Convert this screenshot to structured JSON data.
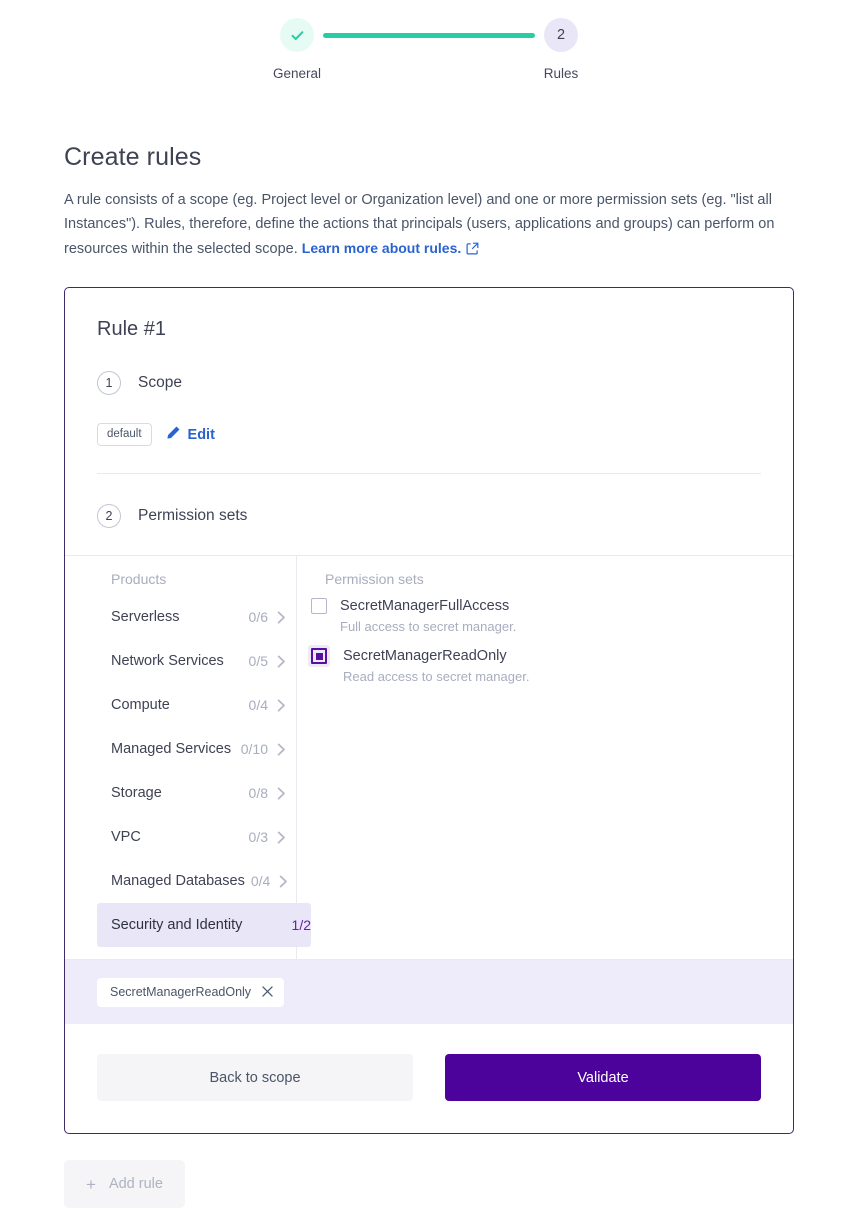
{
  "stepper": {
    "steps": [
      {
        "label": "General",
        "state": "done",
        "icon": "check-icon"
      },
      {
        "label": "Rules",
        "state": "current",
        "number": "2"
      }
    ],
    "line_color": "#27cda5",
    "done_bg": "#e6fbf4",
    "current_bg": "#e9e7f7"
  },
  "page": {
    "title": "Create rules",
    "description_part1": "A rule consists of a scope (eg. Project level or Organization level) and one or more permission sets (eg. \"list all Instances\"). Rules, therefore, define the actions that principals (users, applications and groups) can perform on resources within the selected scope. ",
    "link_text": "Learn more about rules.",
    "link_icon": "external-link-icon"
  },
  "rule_card": {
    "border_color": "#3d2a6b",
    "title": "Rule #1",
    "scope_section": {
      "number": "1",
      "title": "Scope",
      "badge": "default",
      "edit_label": "Edit",
      "edit_icon": "pencil-icon"
    },
    "permission_section": {
      "number": "2",
      "title": "Permission sets"
    },
    "picker": {
      "products_header": "Products",
      "permissions_header": "Permission sets",
      "products": [
        {
          "name": "Serverless",
          "count": "0/6",
          "selected": false
        },
        {
          "name": "Network Services",
          "count": "0/5",
          "selected": false
        },
        {
          "name": "Compute",
          "count": "0/4",
          "selected": false
        },
        {
          "name": "Managed Services",
          "count": "0/10",
          "selected": false
        },
        {
          "name": "Storage",
          "count": "0/8",
          "selected": false
        },
        {
          "name": "VPC",
          "count": "0/3",
          "selected": false
        },
        {
          "name": "Managed Databases",
          "count": "0/4",
          "selected": false
        },
        {
          "name": "Security and Identity",
          "count": "1/2",
          "selected": true
        }
      ],
      "permissions": [
        {
          "name": "SecretManagerFullAccess",
          "description": "Full access to secret manager.",
          "checked": false
        },
        {
          "name": "SecretManagerReadOnly",
          "description": "Read access to secret manager.",
          "checked": true
        }
      ]
    },
    "chips": [
      {
        "label": "SecretManagerReadOnly",
        "remove_icon": "close-icon"
      }
    ],
    "actions": {
      "back_label": "Back to scope",
      "validate_label": "Validate",
      "primary_color": "#4b039b"
    }
  },
  "footer": {
    "add_rule_label": "Add rule",
    "add_rule_icon": "plus-icon",
    "add_rule_disabled": true
  }
}
